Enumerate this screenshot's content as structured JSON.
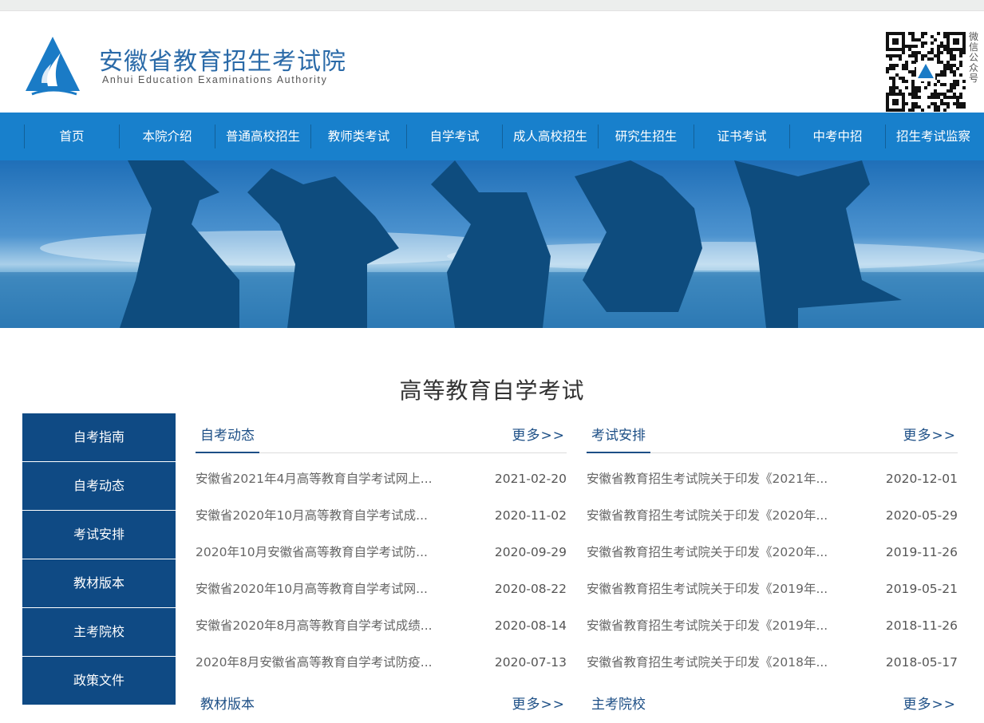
{
  "header": {
    "title": "安徽省教育招生考试院",
    "subtitle": "Anhui Education Examinations Authority",
    "qr_caption": "微信公众号"
  },
  "nav": [
    "首页",
    "本院介绍",
    "普通高校招生",
    "教师类考试",
    "自学考试",
    "成人高校招生",
    "研究生招生",
    "证书考试",
    "中考中招",
    "招生考试监察"
  ],
  "section_title": "高等教育自学考试",
  "sidebar": [
    "自考指南",
    "自考动态",
    "考试安排",
    "教材版本",
    "主考院校",
    "政策文件"
  ],
  "panels": [
    {
      "tab": "自考动态",
      "more": "更多>>",
      "items": [
        {
          "title": "安徽省2021年4月高等教育自学考试网上...",
          "date": "2021-02-20"
        },
        {
          "title": "安徽省2020年10月高等教育自学考试成...",
          "date": "2020-11-02"
        },
        {
          "title": "2020年10月安徽省高等教育自学考试防...",
          "date": "2020-09-29"
        },
        {
          "title": "安徽省2020年10月高等教育自学考试网...",
          "date": "2020-08-22"
        },
        {
          "title": "安徽省2020年8月高等教育自学考试成绩...",
          "date": "2020-08-14"
        },
        {
          "title": "2020年8月安徽省高等教育自学考试防疫...",
          "date": "2020-07-13"
        }
      ]
    },
    {
      "tab": "考试安排",
      "more": "更多>>",
      "items": [
        {
          "title": "安徽省教育招生考试院关于印发《2021年...",
          "date": "2020-12-01"
        },
        {
          "title": "安徽省教育招生考试院关于印发《2020年...",
          "date": "2020-05-29"
        },
        {
          "title": "安徽省教育招生考试院关于印发《2020年...",
          "date": "2019-11-26"
        },
        {
          "title": "安徽省教育招生考试院关于印发《2019年...",
          "date": "2019-05-21"
        },
        {
          "title": "安徽省教育招生考试院关于印发《2019年...",
          "date": "2018-11-26"
        },
        {
          "title": "安徽省教育招生考试院关于印发《2018年...",
          "date": "2018-05-17"
        }
      ]
    }
  ],
  "lower_panels": [
    {
      "tab": "教材版本",
      "more": "更多>>"
    },
    {
      "tab": "主考院校",
      "more": "更多>>"
    }
  ],
  "colors": {
    "nav": "#1880cc",
    "sidebar": "#0f4a84",
    "accent": "#1d4f86"
  }
}
